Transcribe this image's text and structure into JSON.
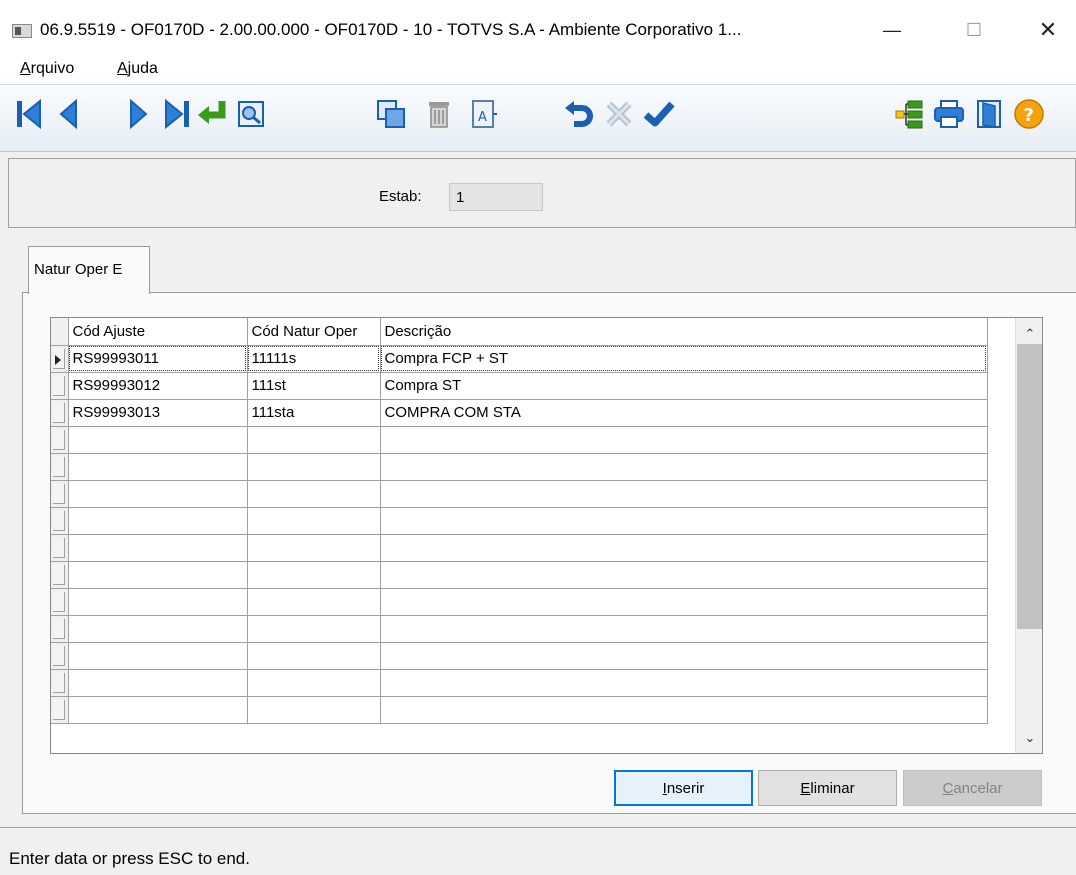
{
  "window": {
    "title": "06.9.5519 - OF0170D - 2.00.00.000 - OF0170D - 10 - TOTVS S.A - Ambiente Corporativo 1...",
    "minimize_glyph": "—",
    "maximize_glyph": "☐",
    "close_glyph": "✕"
  },
  "menu": {
    "arquivo_hotkey": "A",
    "arquivo_rest": "rquivo",
    "ajuda_hotkey": "A",
    "ajuda_rest": "juda"
  },
  "toolbar": {
    "icons": [
      "first-record-icon",
      "previous-record-icon",
      "next-record-icon",
      "last-record-icon",
      "goto-icon",
      "search-icon",
      "copy-icon",
      "delete-icon",
      "rename-icon",
      "undo-icon",
      "cancel-icon",
      "confirm-icon",
      "hierarchy-icon",
      "print-icon",
      "exit-icon",
      "help-icon"
    ]
  },
  "header": {
    "estab_label": "Estab:",
    "estab_value": "1"
  },
  "tab": {
    "label": "Natur Oper E"
  },
  "grid": {
    "columns": [
      "Cód Ajuste",
      "Cód Natur Oper",
      "Descrição"
    ],
    "rows": [
      [
        "RS99993011",
        "11111s",
        "Compra FCP + ST"
      ],
      [
        "RS99993012",
        "111st",
        "Compra ST"
      ],
      [
        "RS99993013",
        "111sta",
        "COMPRA COM STA"
      ],
      [
        "",
        "",
        ""
      ],
      [
        "",
        "",
        ""
      ],
      [
        "",
        "",
        ""
      ],
      [
        "",
        "",
        ""
      ],
      [
        "",
        "",
        ""
      ],
      [
        "",
        "",
        ""
      ],
      [
        "",
        "",
        ""
      ],
      [
        "",
        "",
        ""
      ],
      [
        "",
        "",
        ""
      ],
      [
        "",
        "",
        ""
      ],
      [
        "",
        "",
        ""
      ]
    ],
    "scroll_up_glyph": "⌃",
    "scroll_down_glyph": "⌄"
  },
  "buttons": {
    "inserir_hotkey": "I",
    "inserir_rest": "nserir",
    "eliminar_hotkey": "E",
    "eliminar_rest": "liminar",
    "cancelar_hotkey": "C",
    "cancelar_rest": "ancelar"
  },
  "status": {
    "text": "Enter data or press ESC to end."
  },
  "colors": {
    "toolbar_blue": "#1a5fb4",
    "confirm_green": "#3a9a1a",
    "help_orange": "#f5a30a"
  }
}
